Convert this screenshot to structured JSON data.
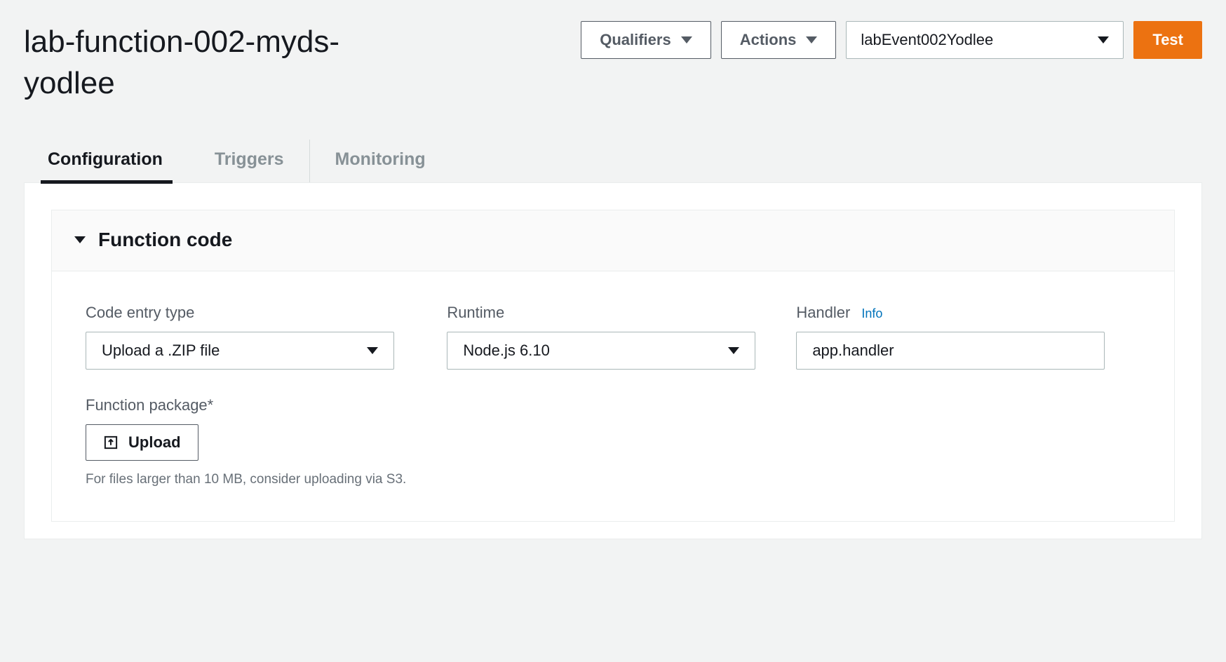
{
  "header": {
    "title": "lab-function-002-myds-yodlee",
    "qualifiers_label": "Qualifiers",
    "actions_label": "Actions",
    "event_selected": "labEvent002Yodlee",
    "test_label": "Test"
  },
  "tabs": {
    "items": [
      {
        "label": "Configuration",
        "active": true
      },
      {
        "label": "Triggers",
        "active": false
      },
      {
        "label": "Monitoring",
        "active": false
      }
    ]
  },
  "card": {
    "title": "Function code"
  },
  "form": {
    "code_entry_type": {
      "label": "Code entry type",
      "value": "Upload a .ZIP file"
    },
    "runtime": {
      "label": "Runtime",
      "value": "Node.js 6.10"
    },
    "handler": {
      "label": "Handler",
      "info": "Info",
      "value": "app.handler"
    },
    "package": {
      "label": "Function package*",
      "button": "Upload",
      "hint": "For files larger than 10 MB, consider uploading via S3."
    }
  }
}
